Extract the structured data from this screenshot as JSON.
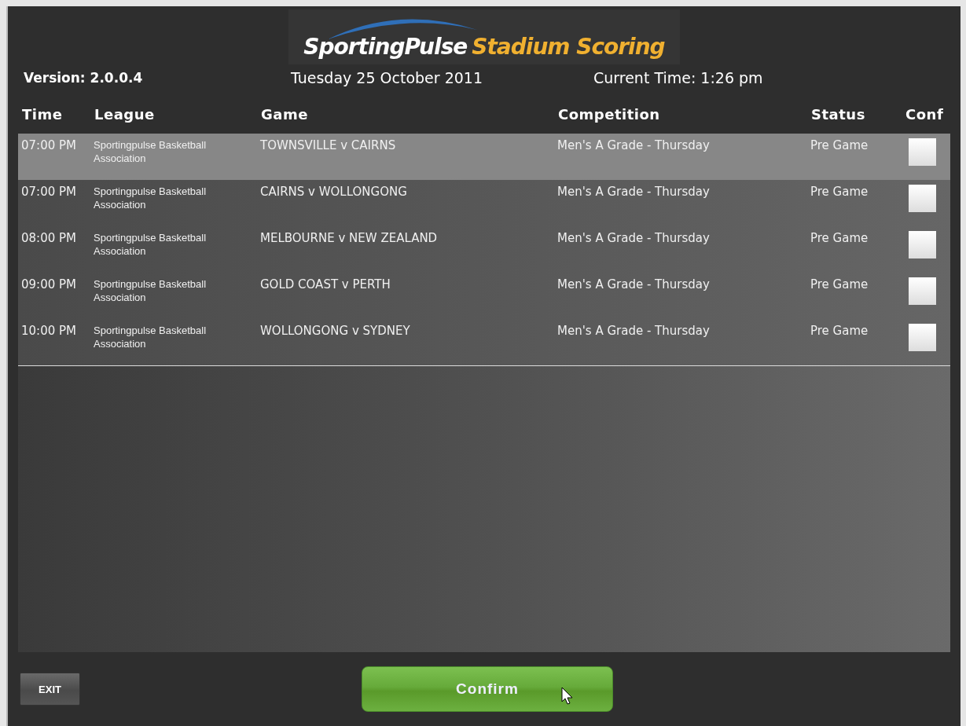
{
  "logo": {
    "brand": "SportingPulse",
    "product": "Stadium Scoring"
  },
  "version": "Version: 2.0.0.4",
  "date": "Tuesday 25 October  2011",
  "current_time": "Current Time: 1:26 pm",
  "table": {
    "columns": [
      "Time",
      "League",
      "Game",
      "Competition",
      "Status",
      "Conf"
    ],
    "rows": [
      {
        "time": "07:00 PM",
        "league": "Sportingpulse Basketball Association",
        "game": "TOWNSVILLE v CAIRNS",
        "competition": "Men's A Grade - Thursday",
        "status": "Pre Game",
        "checked": false,
        "selected": true
      },
      {
        "time": "07:00 PM",
        "league": "Sportingpulse Basketball Association",
        "game": "CAIRNS v WOLLONGONG",
        "competition": "Men's A Grade - Thursday",
        "status": "Pre Game",
        "checked": false,
        "selected": false
      },
      {
        "time": "08:00 PM",
        "league": "Sportingpulse Basketball Association",
        "game": "MELBOURNE v NEW ZEALAND",
        "competition": "Men's A Grade - Thursday",
        "status": "Pre Game",
        "checked": false,
        "selected": false
      },
      {
        "time": "09:00 PM",
        "league": "Sportingpulse Basketball Association",
        "game": "GOLD COAST v PERTH",
        "competition": "Men's A Grade - Thursday",
        "status": "Pre Game",
        "checked": false,
        "selected": false
      },
      {
        "time": "10:00 PM",
        "league": "Sportingpulse Basketball Association",
        "game": "WOLLONGONG v SYDNEY",
        "competition": "Men's A Grade - Thursday",
        "status": "Pre Game",
        "checked": false,
        "selected": false
      }
    ]
  },
  "buttons": {
    "exit": "EXIT",
    "confirm": "Confirm"
  }
}
